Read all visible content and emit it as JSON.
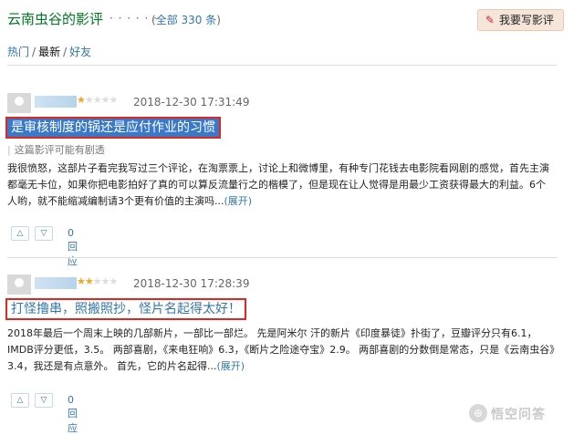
{
  "header": {
    "title": "云南虫谷的影评",
    "dots": "· · · · · ·",
    "total_prefix": "(",
    "total_link": "全部 330 条",
    "total_suffix": ")",
    "write_button": "我要写影评"
  },
  "sort": {
    "hot": "热门",
    "sep": "/",
    "latest": "最新",
    "friends": "好友"
  },
  "reviews": [
    {
      "rating": 1,
      "max_rating": 5,
      "time": "2018-12-30 17:31:49",
      "title": "是审核制度的锅还是应付作业的习惯",
      "warning": "这篇影评可能有剧透",
      "body": "我很愤怒，这部片子看完我写过三个评论，在淘票票上，讨论上和微博里，有种专门花钱去电影院看网剧的感觉，首先主演都毫无卡位，如果你把电影拍好了真的可以算反流量行之的楷模了，但是现在让人觉得是用最少工资获得最大的利益。6个人哟，就不能缩减编制请3个更有价值的主演吗...",
      "expand": "(展开)",
      "replies": "0回应"
    },
    {
      "rating": 2,
      "max_rating": 5,
      "time": "2018-12-30 17:28:39",
      "title": "打怪撸串，照搬照抄，怪片名起得太好！",
      "body": "2018年最后一个周末上映的几部新片，一部比一部烂。 先是阿米尔 汗的新片《印度暴徒》扑街了，豆瓣评分只有6.1，IMDB评分更低，3.5。 两部喜剧，《来电狂响》6.3，《断片之险途夺宝》2.9。 两部喜剧的分数倒是常态，只是《云南虫谷》3.4，我还是有点意外。 首先，它的片名起得...",
      "expand": "(展开)",
      "replies": "0回应"
    }
  ],
  "vote_up": "△",
  "vote_down": "▽",
  "watermark": {
    "logo": "⊕",
    "text": "悟空问答"
  }
}
